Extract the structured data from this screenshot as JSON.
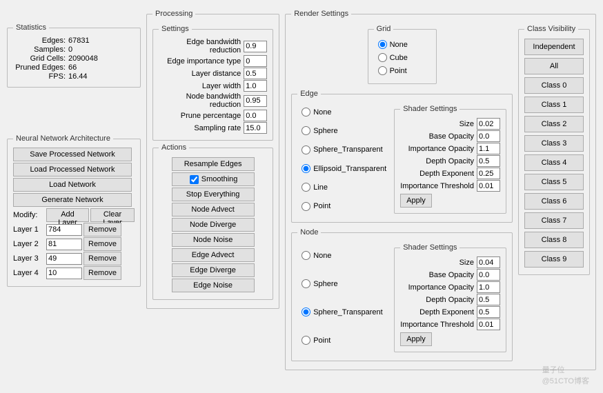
{
  "statistics": {
    "legend": "Statistics",
    "rows": [
      {
        "label": "Edges:",
        "value": "67831"
      },
      {
        "label": "Samples:",
        "value": "0"
      },
      {
        "label": "Grid Cells:",
        "value": "2090048"
      },
      {
        "label": "Pruned Edges:",
        "value": "66"
      },
      {
        "label": "FPS:",
        "value": "16.44"
      }
    ]
  },
  "architecture": {
    "legend": "Neural Network Architecture",
    "btn_save": "Save Processed Network",
    "btn_load_proc": "Load Processed Network",
    "btn_load": "Load Network",
    "btn_gen": "Generate Network",
    "modify_label": "Modify:",
    "btn_add_layer": "Add Layer",
    "btn_clear_layer": "Clear Layer",
    "btn_remove": "Remove",
    "layers": [
      {
        "label": "Layer 1",
        "value": "784"
      },
      {
        "label": "Layer 2",
        "value": "81"
      },
      {
        "label": "Layer 3",
        "value": "49"
      },
      {
        "label": "Layer 4",
        "value": "10"
      }
    ]
  },
  "processing": {
    "legend": "Processing",
    "settings_legend": "Settings",
    "settings": [
      {
        "label": "Edge bandwidth reduction",
        "value": "0.9"
      },
      {
        "label": "Edge importance type",
        "value": "0"
      },
      {
        "label": "Layer distance",
        "value": "0.5"
      },
      {
        "label": "Layer width",
        "value": "1.0"
      },
      {
        "label": "Node bandwidth reduction",
        "value": "0.95"
      },
      {
        "label": "Prune percentage",
        "value": "0.0"
      },
      {
        "label": "Sampling rate",
        "value": "15.0"
      }
    ],
    "actions_legend": "Actions",
    "smoothing_label": "Smoothing",
    "actions": {
      "resample": "Resample Edges",
      "stop": "Stop Everything",
      "node_advect": "Node Advect",
      "node_diverge": "Node Diverge",
      "node_noise": "Node Noise",
      "edge_advect": "Edge Advect",
      "edge_diverge": "Edge Diverge",
      "edge_noise": "Edge Noise"
    }
  },
  "render": {
    "legend": "Render Settings",
    "grid": {
      "legend": "Grid",
      "options": [
        "None",
        "Cube",
        "Point"
      ],
      "selected": "None"
    },
    "edge": {
      "legend": "Edge",
      "options": [
        "None",
        "Sphere",
        "Sphere_Transparent",
        "Ellipsoid_Transparent",
        "Line",
        "Point"
      ],
      "selected": "Ellipsoid_Transparent",
      "shader_legend": "Shader Settings",
      "shader": [
        {
          "label": "Size",
          "value": "0.02"
        },
        {
          "label": "Base Opacity",
          "value": "0.0"
        },
        {
          "label": "Importance Opacity",
          "value": "1.1"
        },
        {
          "label": "Depth Opacity",
          "value": "0.5"
        },
        {
          "label": "Depth Exponent",
          "value": "0.25"
        },
        {
          "label": "Importance Threshold",
          "value": "0.01"
        }
      ],
      "apply": "Apply"
    },
    "node": {
      "legend": "Node",
      "options": [
        "None",
        "Sphere",
        "Sphere_Transparent",
        "Point"
      ],
      "selected": "Sphere_Transparent",
      "shader_legend": "Shader Settings",
      "shader": [
        {
          "label": "Size",
          "value": "0.04"
        },
        {
          "label": "Base Opacity",
          "value": "0.0"
        },
        {
          "label": "Importance Opacity",
          "value": "1.0"
        },
        {
          "label": "Depth Opacity",
          "value": "0.5"
        },
        {
          "label": "Depth Exponent",
          "value": "0.5"
        },
        {
          "label": "Importance Threshold",
          "value": "0.01"
        }
      ],
      "apply": "Apply"
    },
    "visibility": {
      "legend": "Class Visibility",
      "buttons": [
        "Independent",
        "All",
        "Class 0",
        "Class 1",
        "Class 2",
        "Class 3",
        "Class 4",
        "Class 5",
        "Class 6",
        "Class 7",
        "Class 8",
        "Class 9"
      ]
    }
  },
  "watermark": {
    "line1": "量子位",
    "line2": "@51CTO博客"
  }
}
